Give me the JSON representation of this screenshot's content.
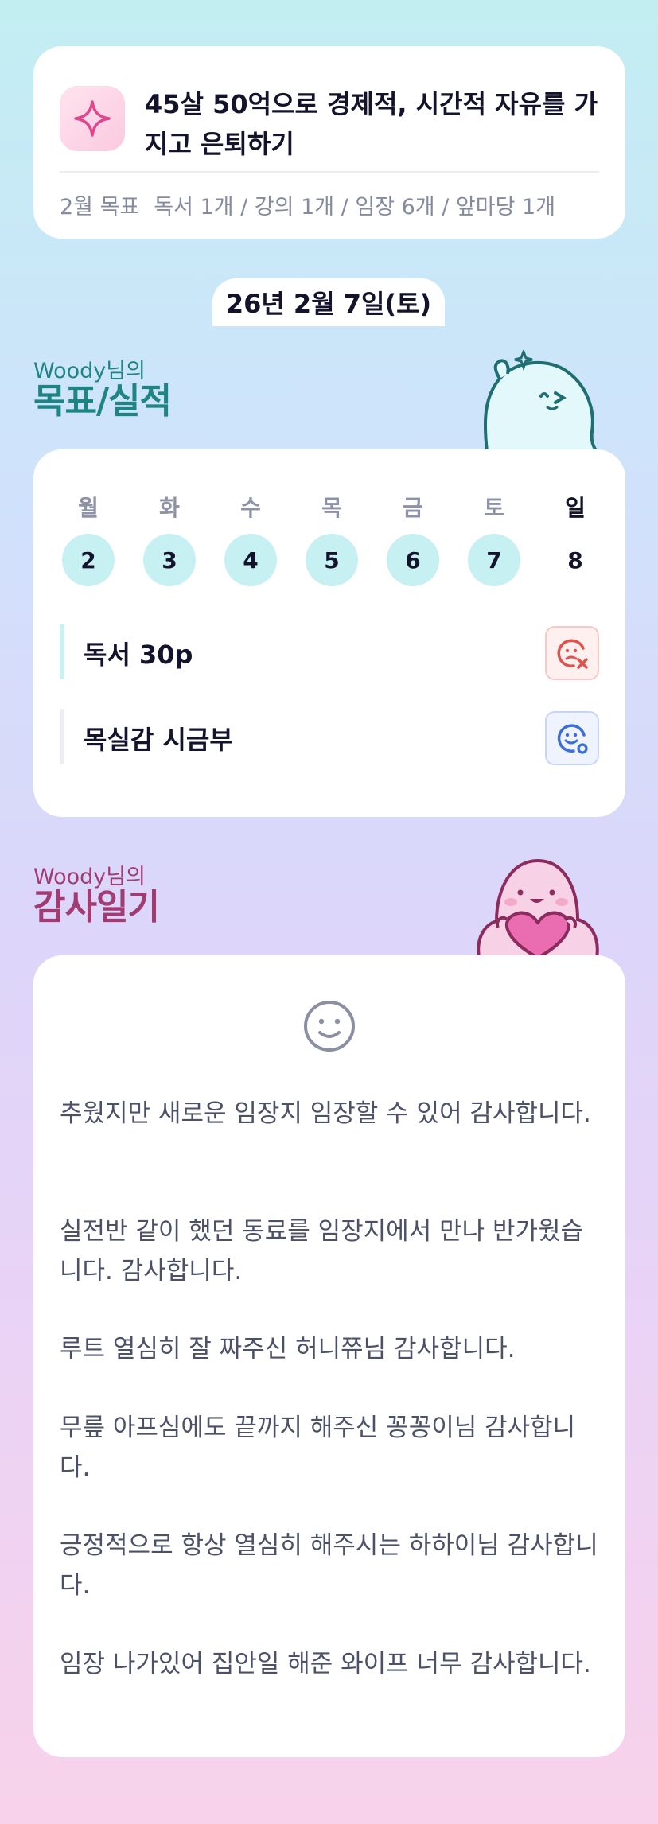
{
  "goal": {
    "title": "45살 50억으로 경제적, 시간적 자유를 가지고 은퇴하기",
    "monthly_label": "2월 목표",
    "monthly_items": "독서 1개 / 강의 1개 / 임장 6개 / 앞마당 1개",
    "icon": "sparkle-icon"
  },
  "date_label": "26년 2월 7일(토)",
  "goal_section": {
    "sub": "Woody님의",
    "main": "목표/실적"
  },
  "week": {
    "days": [
      {
        "name": "월",
        "num": "2",
        "marked": true
      },
      {
        "name": "화",
        "num": "3",
        "marked": true
      },
      {
        "name": "수",
        "num": "4",
        "marked": true
      },
      {
        "name": "목",
        "num": "5",
        "marked": true
      },
      {
        "name": "금",
        "num": "6",
        "marked": true
      },
      {
        "name": "토",
        "num": "7",
        "marked": true
      },
      {
        "name": "일",
        "num": "8",
        "marked": false
      }
    ],
    "tasks": [
      {
        "label": "독서 30p",
        "status": "failed",
        "icon": "sad-face-x-icon",
        "color": "#e1534a"
      },
      {
        "label": "목실감 시금부",
        "status": "done",
        "icon": "smile-face-check-icon",
        "color": "#3a6fd8"
      }
    ]
  },
  "gratitude_section": {
    "sub": "Woody님의",
    "main": "감사일기"
  },
  "gratitude": {
    "icon": "smile-face-icon",
    "entries": [
      "추웠지만 새로운 임장지 임장할 수 있어 감사합니다.",
      "실전반 같이 했던 동료를 임장지에서 만나 반가웠습니다. 감사합니다.",
      "루트 열심히 잘 짜주신 허니쮸님 감사합니다.",
      "무릎 아프심에도 끝까지 해주신 꽁꽁이님 감사합니다.",
      "긍정적으로 항상 열심히 해주시는 하하이님 감사합니다.",
      "임장 나가있어 집안일 해준 와이프 너무 감사합니다."
    ]
  },
  "colors": {
    "teal": "#1f8584",
    "magenta": "#a33b73",
    "day_circle": "#c7f0f3"
  }
}
